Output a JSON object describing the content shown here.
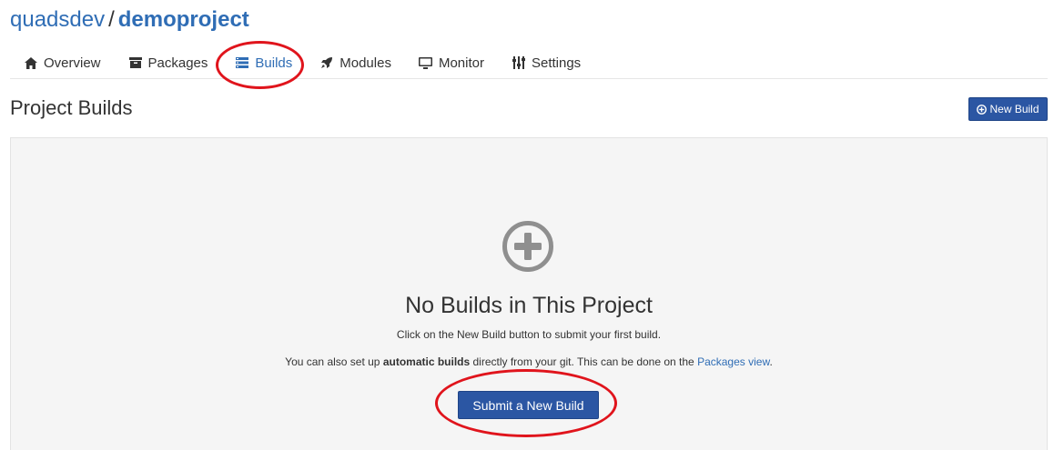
{
  "header": {
    "owner": "quadsdev",
    "separator": "/",
    "project": "demoproject"
  },
  "tabs": [
    {
      "label": "Overview",
      "icon": "home-icon"
    },
    {
      "label": "Packages",
      "icon": "archive-icon"
    },
    {
      "label": "Builds",
      "icon": "list-icon",
      "active": true
    },
    {
      "label": "Modules",
      "icon": "rocket-icon"
    },
    {
      "label": "Monitor",
      "icon": "desktop-icon"
    },
    {
      "label": "Settings",
      "icon": "sliders-icon"
    }
  ],
  "section": {
    "title": "Project Builds",
    "new_build_label": "New Build"
  },
  "empty": {
    "icon": "plus-circle-icon",
    "title": "No Builds in This Project",
    "line1": "Click on the New Build button to submit your first build.",
    "line2_prefix": "You can also set up ",
    "line2_bold": "automatic builds",
    "line2_middle": " directly from your git. This can be done on the ",
    "line2_link": "Packages view",
    "line2_suffix": ".",
    "submit_label": "Submit a New Build"
  },
  "colors": {
    "accent": "#2f6db5",
    "button": "#2b56a3",
    "annotation": "#e0141c",
    "panel": "#f5f5f5"
  }
}
